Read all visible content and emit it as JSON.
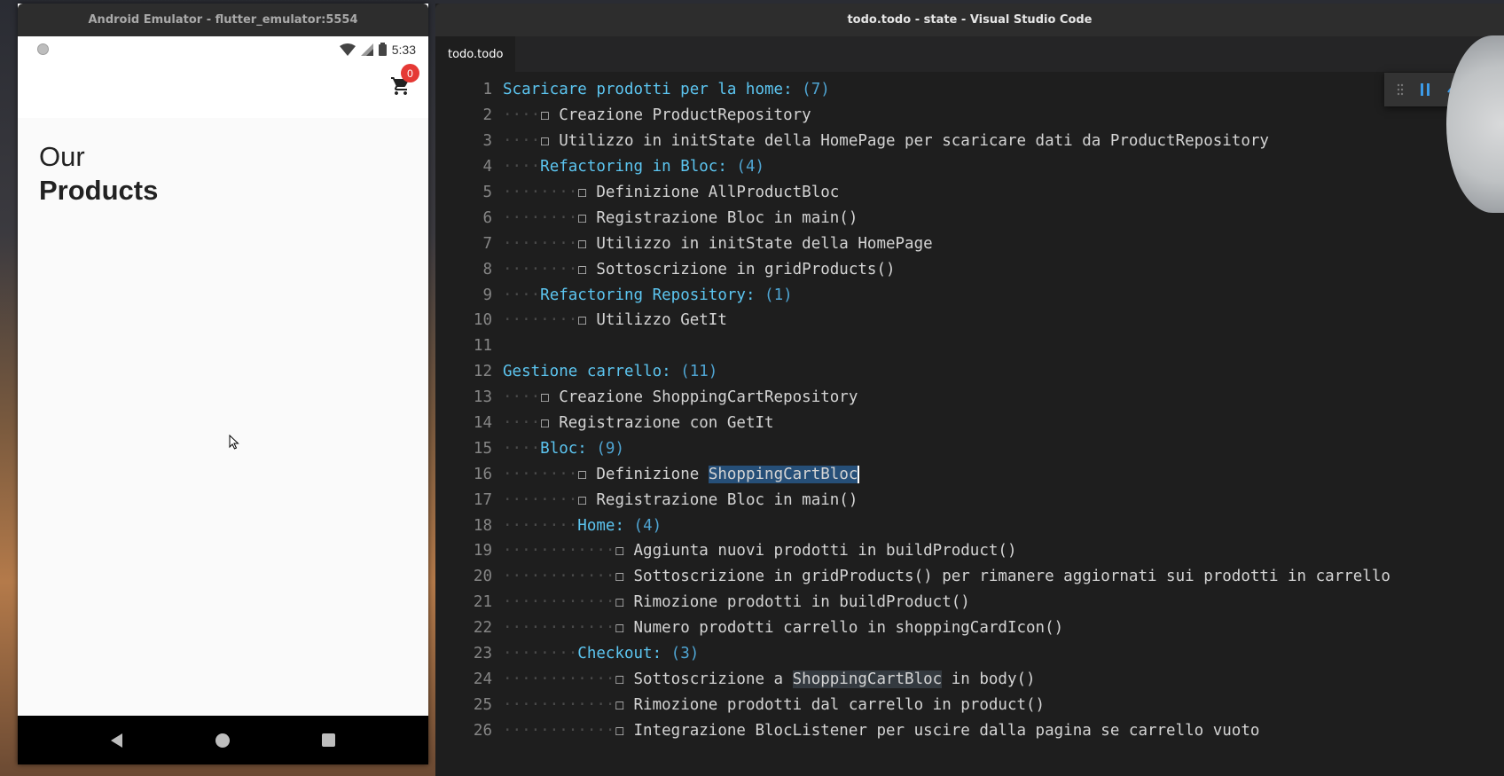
{
  "emulator": {
    "title": "Android Emulator - flutter_emulator:5554",
    "status_time": "5:33",
    "cart_count": "0",
    "heading_line1": "Our",
    "heading_line2": "Products"
  },
  "vscode": {
    "title": "todo.todo - state - Visual Studio Code",
    "tab_label": "todo.todo",
    "lines": [
      {
        "n": "1",
        "indent": "",
        "project": "Scaricare prodotti per la home:",
        "count": "(7)"
      },
      {
        "n": "2",
        "indent": "····",
        "text": "☐ Creazione ProductRepository"
      },
      {
        "n": "3",
        "indent": "····",
        "text": "☐ Utilizzo in initState della HomePage per scaricare dati da ProductRepository"
      },
      {
        "n": "4",
        "indent": "····",
        "project": "Refactoring in Bloc:",
        "count": "(4)"
      },
      {
        "n": "5",
        "indent": "········",
        "text": "☐ Definizione AllProductBloc"
      },
      {
        "n": "6",
        "indent": "········",
        "text": "☐ Registrazione Bloc in main()"
      },
      {
        "n": "7",
        "indent": "········",
        "text": "☐ Utilizzo in initState della HomePage"
      },
      {
        "n": "8",
        "indent": "········",
        "text": "☐ Sottoscrizione in gridProducts()"
      },
      {
        "n": "9",
        "indent": "····",
        "project": "Refactoring Repository:",
        "count": "(1)"
      },
      {
        "n": "10",
        "indent": "········",
        "text": "☐ Utilizzo GetIt"
      },
      {
        "n": "11",
        "indent": "",
        "text": ""
      },
      {
        "n": "12",
        "indent": "",
        "project": "Gestione carrello:",
        "count": "(11)"
      },
      {
        "n": "13",
        "indent": "····",
        "text": "☐ Creazione ShoppingCartRepository"
      },
      {
        "n": "14",
        "indent": "····",
        "text": "☐ Registrazione con GetIt"
      },
      {
        "n": "15",
        "indent": "····",
        "project": "Bloc:",
        "count": "(9)"
      },
      {
        "n": "16",
        "indent": "········",
        "text": "☐ Definizione ",
        "selected": "ShoppingCartBloc"
      },
      {
        "n": "17",
        "indent": "········",
        "text": "☐ Registrazione Bloc in main()"
      },
      {
        "n": "18",
        "indent": "········",
        "project": "Home:",
        "count": "(4)"
      },
      {
        "n": "19",
        "indent": "············",
        "text": "☐ Aggiunta nuovi prodotti in buildProduct()"
      },
      {
        "n": "20",
        "indent": "············",
        "text": "☐ Sottoscrizione in gridProducts() per rimanere aggiornati sui prodotti in carrello"
      },
      {
        "n": "21",
        "indent": "············",
        "text": "☐ Rimozione prodotti in buildProduct()"
      },
      {
        "n": "22",
        "indent": "············",
        "text": "☐ Numero prodotti carrello in shoppingCardIcon()"
      },
      {
        "n": "23",
        "indent": "········",
        "project": "Checkout:",
        "count": "(3)"
      },
      {
        "n": "24",
        "indent": "············",
        "text": "☐ Sottoscrizione a ",
        "highlight": "ShoppingCartBloc",
        "after": " in body()"
      },
      {
        "n": "25",
        "indent": "············",
        "text": "☐ Rimozione prodotti dal carrello in product()"
      },
      {
        "n": "26",
        "indent": "············",
        "text": "☐ Integrazione BlocListener per uscire dalla pagina se carrello vuoto"
      }
    ]
  },
  "icons": [
    "wifi-icon",
    "signal-icon",
    "battery-icon",
    "shopping-cart-icon",
    "mouse-cursor-icon",
    "nav-back-icon",
    "nav-home-icon",
    "nav-recent-icon",
    "drag-handle-icon",
    "pause-icon",
    "step-over-icon"
  ],
  "colors": {
    "project_heading": "#5cc5f0",
    "count": "#4fa5d3",
    "selection": "#264f78",
    "badge": "#e53935"
  }
}
